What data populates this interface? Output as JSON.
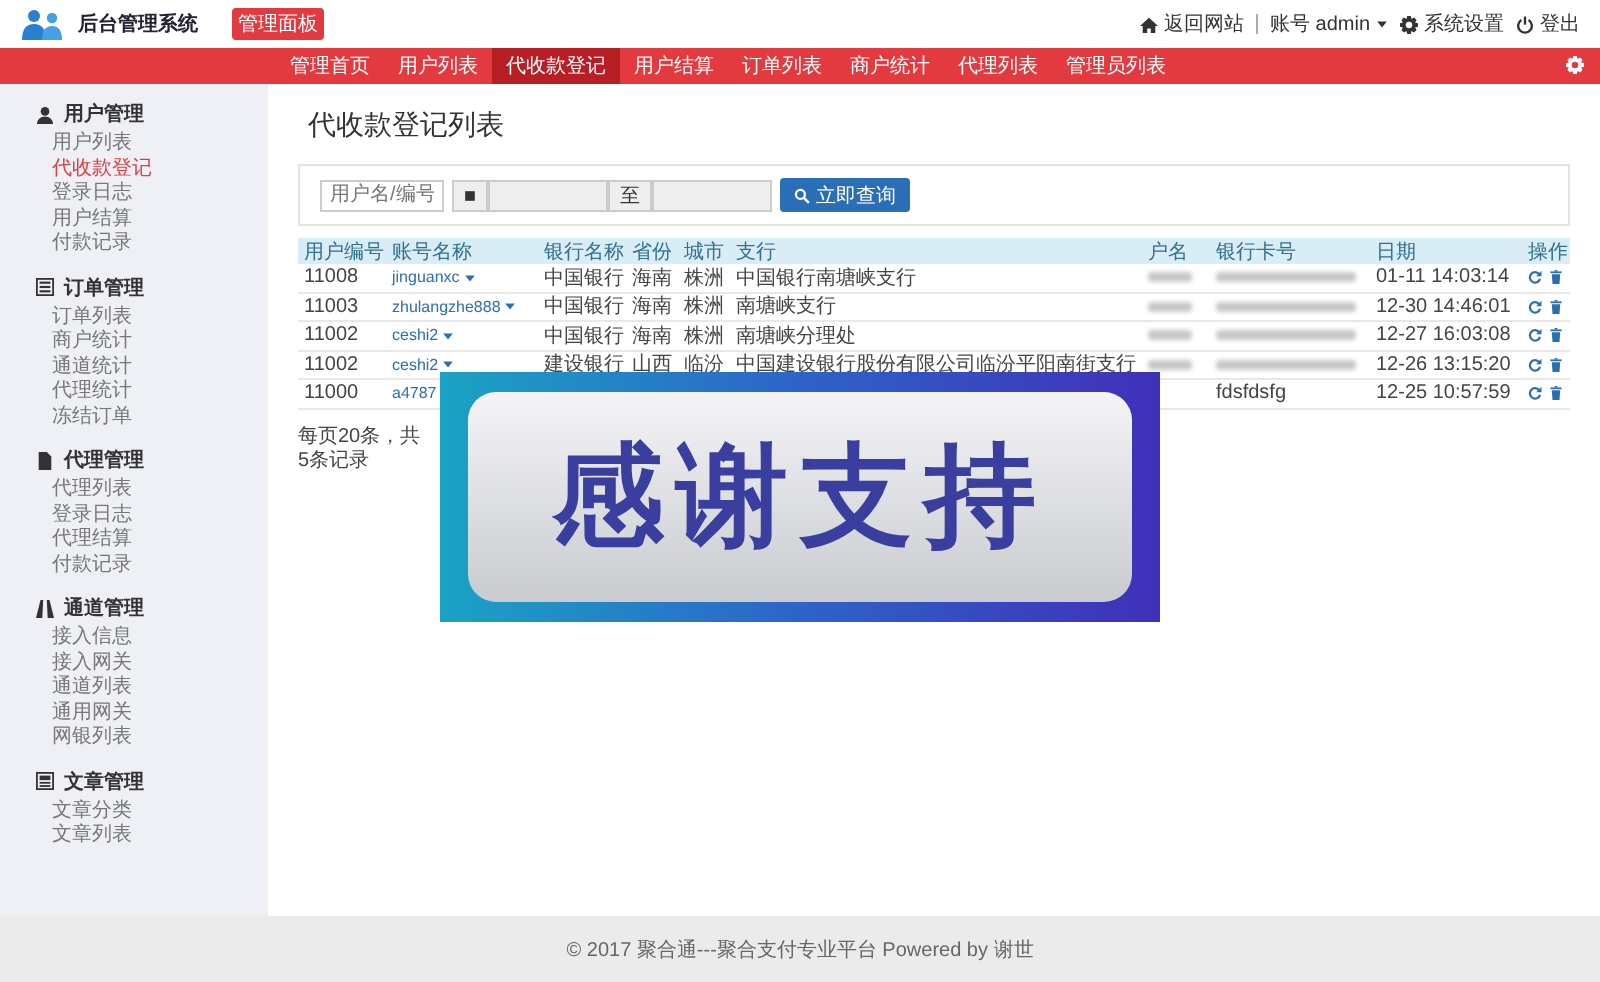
{
  "header": {
    "logo_title": "后台管理系统",
    "badge": "管理面板",
    "links": [
      {
        "kind": "home",
        "label": "返回网站"
      },
      {
        "kind": "account",
        "label": "账号 admin"
      },
      {
        "kind": "settings",
        "label": "系统设置"
      },
      {
        "kind": "logout",
        "label": "登出"
      }
    ]
  },
  "nav": [
    {
      "label": "管理首页",
      "selected": false
    },
    {
      "label": "用户列表",
      "selected": false
    },
    {
      "label": "代收款登记",
      "selected": true
    },
    {
      "label": "用户结算",
      "selected": false
    },
    {
      "label": "订单列表",
      "selected": false
    },
    {
      "label": "商户统计",
      "selected": false
    },
    {
      "label": "代理列表",
      "selected": false
    },
    {
      "label": "管理员列表",
      "selected": false
    }
  ],
  "sidebar": [
    {
      "title": "用户管理",
      "items": [
        {
          "label": "用户列表",
          "selected": false
        },
        {
          "label": "代收款登记",
          "selected": true
        },
        {
          "label": "登录日志",
          "selected": false
        },
        {
          "label": "用户结算",
          "selected": false
        },
        {
          "label": "付款记录",
          "selected": false
        }
      ]
    },
    {
      "title": "订单管理",
      "items": [
        {
          "label": "订单列表",
          "selected": false
        },
        {
          "label": "商户统计",
          "selected": false
        },
        {
          "label": "通道统计",
          "selected": false
        },
        {
          "label": "代理统计",
          "selected": false
        },
        {
          "label": "冻结订单",
          "selected": false
        }
      ]
    },
    {
      "title": "代理管理",
      "items": [
        {
          "label": "代理列表",
          "selected": false
        },
        {
          "label": "登录日志",
          "selected": false
        },
        {
          "label": "代理结算",
          "selected": false
        },
        {
          "label": "付款记录",
          "selected": false
        }
      ]
    },
    {
      "title": "通道管理",
      "items": [
        {
          "label": "接入信息",
          "selected": false
        },
        {
          "label": "接入网关",
          "selected": false
        },
        {
          "label": "通道列表",
          "selected": false
        },
        {
          "label": "通用网关",
          "selected": false
        },
        {
          "label": "网银列表",
          "selected": false
        }
      ]
    },
    {
      "title": "文章管理",
      "items": [
        {
          "label": "文章分类",
          "selected": false
        },
        {
          "label": "文章列表",
          "selected": false
        }
      ]
    }
  ],
  "page_title": "代收款登记列表",
  "search": {
    "user_placeholder": "用户名/编号",
    "separator": "至",
    "button": "立即查询"
  },
  "table": {
    "columns": [
      "用户编号",
      "账号名称",
      "银行名称",
      "省份",
      "城市",
      "支行",
      "户名",
      "银行卡号",
      "日期",
      "操作"
    ],
    "rows": [
      {
        "id": "11008",
        "account": "jinguanxc",
        "bank": "中国银行",
        "province": "海南",
        "city": "株洲",
        "branch": "中国银行南塘峡支行",
        "name_blurred": true,
        "card_blurred": true,
        "date": "01-11 14:03:14"
      },
      {
        "id": "11003",
        "account": "zhulangzhe888",
        "bank": "中国银行",
        "province": "海南",
        "city": "株洲",
        "branch": "南塘峡支行",
        "name_blurred": true,
        "card_blurred": true,
        "date": "12-30 14:46:01"
      },
      {
        "id": "11002",
        "account": "ceshi2",
        "bank": "中国银行",
        "province": "海南",
        "city": "株洲",
        "branch": "南塘峡分理处",
        "name_blurred": true,
        "card_blurred": true,
        "date": "12-27 16:03:08"
      },
      {
        "id": "11002",
        "account": "ceshi2",
        "bank": "建设银行",
        "province": "山西",
        "city": "临汾",
        "branch": "中国建设银行股份有限公司临汾平阳南街支行",
        "name_blurred": true,
        "card_blurred": true,
        "date": "12-26 13:15:20"
      },
      {
        "id": "11000",
        "account": "a4787",
        "card_blurred": false,
        "card": "fdsfdsfg",
        "date": "12-25 10:57:59"
      }
    ]
  },
  "pagination": "每页20条，共5条记录",
  "overlay_banner": {
    "text": "感谢支持"
  },
  "footer": "© 2017 聚合通---聚合支付专业平台 Powered by 谢世"
}
